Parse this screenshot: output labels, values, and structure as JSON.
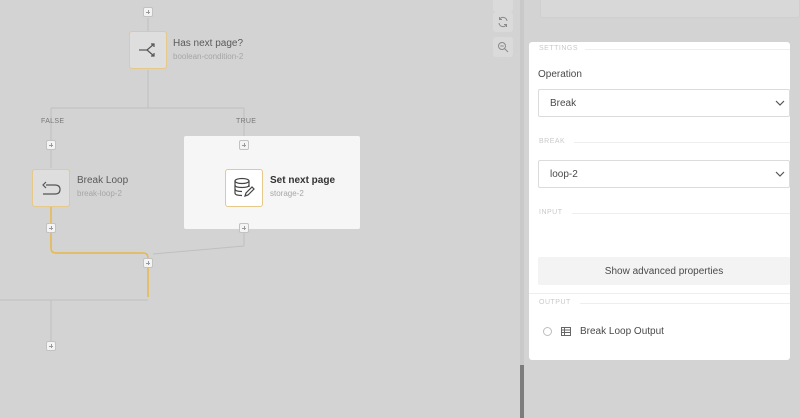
{
  "canvas": {
    "nodes": {
      "condition": {
        "title": "Has next page?",
        "subtitle": "boolean-condition-2",
        "icon": "split-arrow-icon"
      },
      "break_loop": {
        "title": "Break Loop",
        "subtitle": "break-loop-2",
        "icon": "return-arrow-icon"
      },
      "storage": {
        "title": "Set next page",
        "subtitle": "storage-2",
        "icon": "database-edit-icon"
      }
    },
    "branches": {
      "false_label": "FALSE",
      "true_label": "TRUE"
    },
    "toolbar": {
      "refresh_icon": "refresh-icon",
      "zoom_icon": "zoom-out-icon"
    },
    "colors": {
      "selected_path": "#e8b84a",
      "node_border": "#e5c88a"
    }
  },
  "panel": {
    "settings_label": "SETTINGS",
    "operation_label": "Operation",
    "operation_value": "Break",
    "break_label": "BREAK",
    "break_value": "loop-2",
    "input_label": "INPUT",
    "advanced_button": "Show advanced properties",
    "output_label": "OUTPUT",
    "output_item": "Break Loop Output"
  }
}
